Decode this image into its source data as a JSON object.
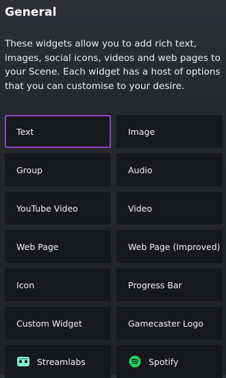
{
  "section": {
    "title": "General",
    "description": "These widgets allow you to add rich text, images, social icons, videos and web pages to your Scene. Each widget has a host of options that you can customise to your desire."
  },
  "colors": {
    "selected_border": "#8a45c8",
    "tile_bg": "#17181b",
    "streamlabs_green": "#80f5d2",
    "spotify_green": "#1ed760"
  },
  "widgets": [
    {
      "label": "Text",
      "selected": true
    },
    {
      "label": "Image",
      "selected": false
    },
    {
      "label": "Group",
      "selected": false
    },
    {
      "label": "Audio",
      "selected": false
    },
    {
      "label": "YouTube Video",
      "selected": false
    },
    {
      "label": "Video",
      "selected": false
    },
    {
      "label": "Web Page",
      "selected": false
    },
    {
      "label": "Web Page (Improved)",
      "selected": false
    },
    {
      "label": "Icon",
      "selected": false
    },
    {
      "label": "Progress Bar",
      "selected": false
    },
    {
      "label": "Custom Widget",
      "selected": false
    },
    {
      "label": "Gamecaster Logo",
      "selected": false
    },
    {
      "label": "Streamlabs",
      "icon": "streamlabs-icon",
      "selected": false
    },
    {
      "label": "Spotify",
      "icon": "spotify-icon",
      "selected": false
    }
  ]
}
